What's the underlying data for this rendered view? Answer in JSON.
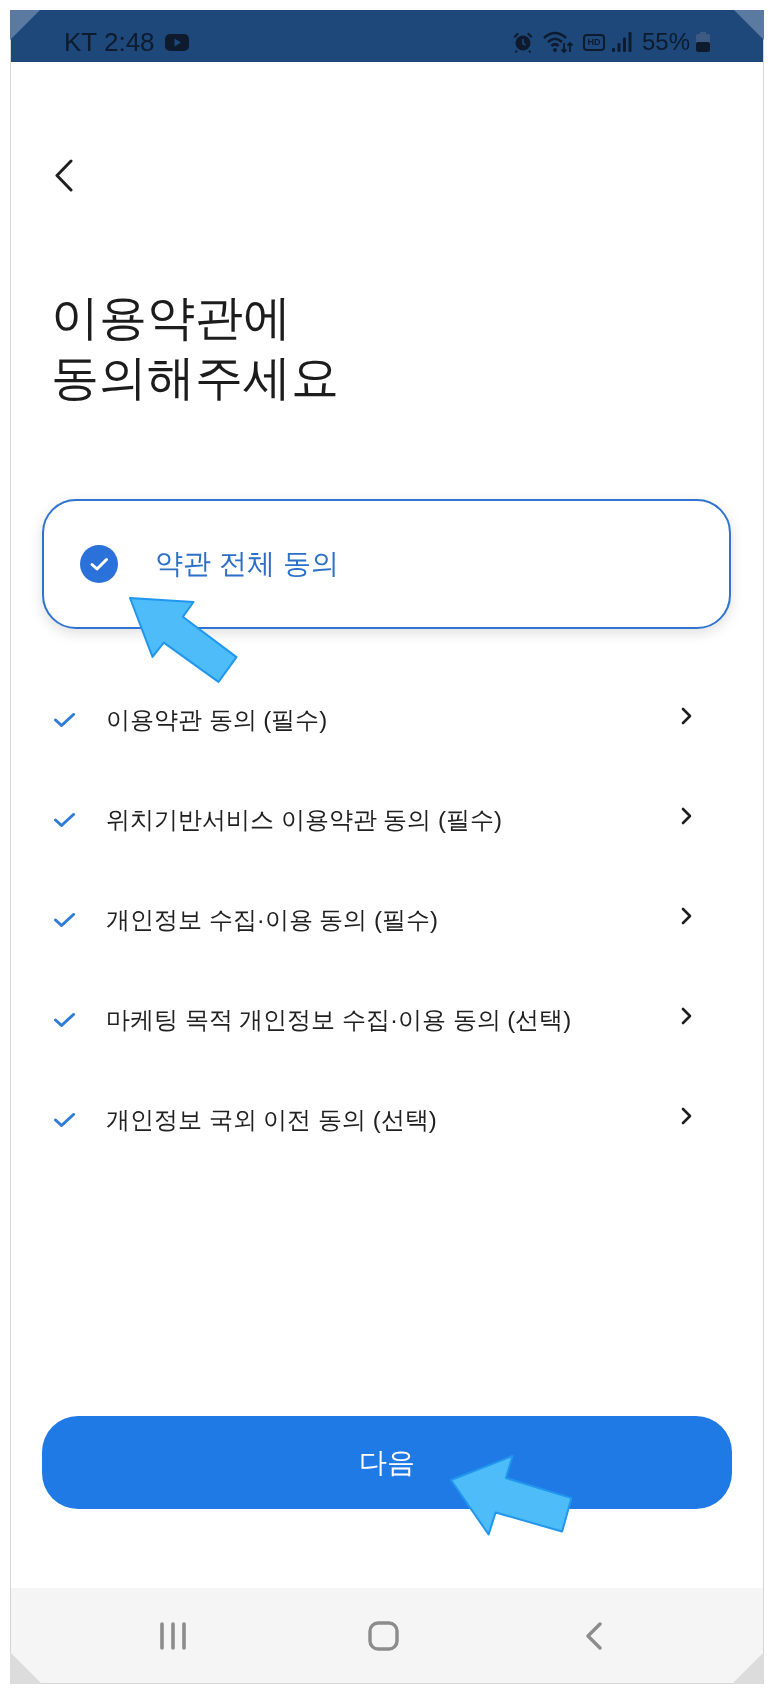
{
  "status_bar": {
    "carrier_time": "KT 2:48",
    "hd_label": "HD",
    "battery": "55%"
  },
  "title_lines": [
    "이용약관에",
    "동의해주세요"
  ],
  "agree_all": {
    "label": "약관 전체 동의",
    "checked": true
  },
  "terms": [
    {
      "label": "이용약관 동의 (필수)",
      "checked": true
    },
    {
      "label": "위치기반서비스 이용약관 동의 (필수)",
      "checked": true
    },
    {
      "label": "개인정보 수집·이용 동의 (필수)",
      "checked": true
    },
    {
      "label": "마케팅 목적 개인정보 수집·이용 동의 (선택)",
      "checked": true
    },
    {
      "label": "개인정보 국외 이전 동의 (선택)",
      "checked": true
    }
  ],
  "next_button": {
    "label": "다음"
  }
}
